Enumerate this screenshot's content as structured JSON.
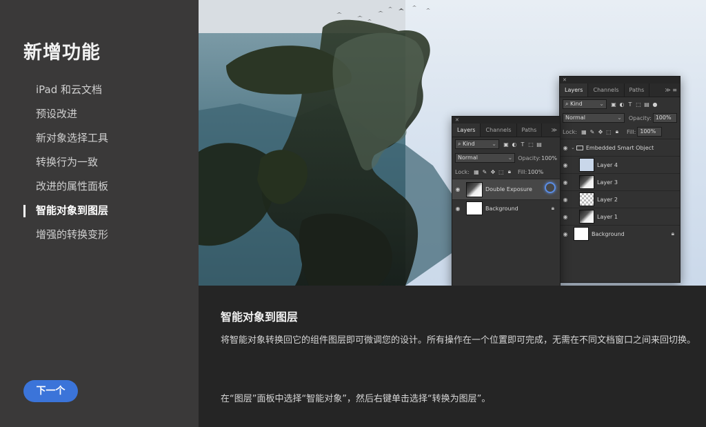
{
  "sidebar": {
    "title": "新增功能",
    "items": [
      {
        "label": "iPad 和云文档"
      },
      {
        "label": "预设改进"
      },
      {
        "label": "新对象选择工具"
      },
      {
        "label": "转换行为一致"
      },
      {
        "label": "改进的属性面板"
      },
      {
        "label": "智能对象到图层"
      },
      {
        "label": "增强的转换变形"
      }
    ],
    "active_index": 5,
    "next_label": "下一个"
  },
  "content": {
    "title": "智能对象到图层",
    "description": "将智能对象转换回它的组件图层即可微调您的设计。所有操作在一个位置即可完成，无需在不同文档窗口之间来回切换。",
    "tip": "在“图层”面板中选择“智能对象”，然后右键单击选择“转换为图层”。"
  },
  "panel_front": {
    "tabs": [
      "Layers",
      "Channels",
      "Paths"
    ],
    "filter": "Kind",
    "blend_mode": "Normal",
    "opacity_label": "Opacity:",
    "opacity_value": "100%",
    "lock_label": "Lock:",
    "fill_label": "Fill:",
    "fill_value": "100%",
    "layers": [
      {
        "name": "Double Exposure"
      },
      {
        "name": "Background"
      }
    ]
  },
  "panel_back": {
    "tabs": [
      "Layers",
      "Channels",
      "Paths"
    ],
    "filter": "Kind",
    "blend_mode": "Normal",
    "opacity_label": "Opacity:",
    "opacity_value": "100%",
    "lock_label": "Lock:",
    "fill_label": "Fill:",
    "fill_value": "100%",
    "group_name": "Embedded Smart Object",
    "layers": [
      {
        "name": "Layer 4"
      },
      {
        "name": "Layer 3"
      },
      {
        "name": "Layer 2"
      },
      {
        "name": "Layer 1"
      },
      {
        "name": "Background"
      }
    ]
  },
  "colors": {
    "accent": "#3b74d9",
    "sidebar_bg": "#3a3939",
    "content_bg": "#252525"
  }
}
